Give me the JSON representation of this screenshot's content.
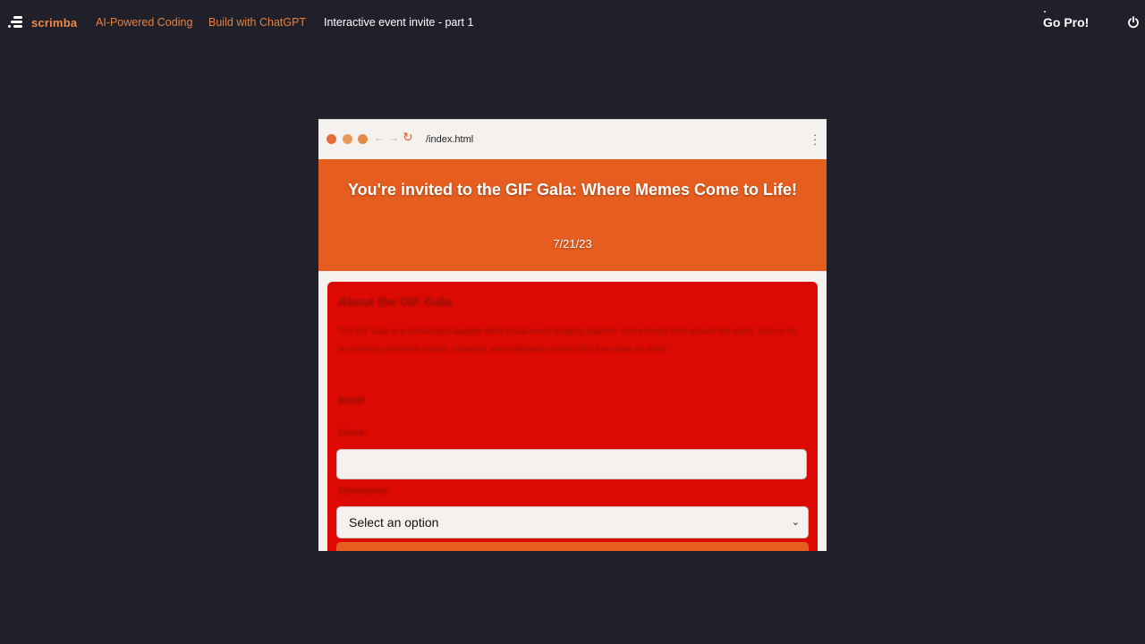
{
  "topbar": {
    "logo_text": "scrimba",
    "breadcrumbs": [
      "AI-Powered Coding",
      "Build with ChatGPT",
      "Interactive event invite - part 1"
    ],
    "go_pro_label": "Go Pro!",
    "power_icon": "power-icon"
  },
  "preview": {
    "url": "/index.html",
    "title": "You're invited to the GIF Gala: Where Memes Come to Life!",
    "date": "7/21/23",
    "card": {
      "heading": "About the GIF Gala",
      "paragraph": "The GIF Gala is a vibrant and laughter-filled virtual event bringing together meme lovers from around the world. Join us for an evening of internet culture, creativity, and celebration of the GIFs that make us smile.",
      "rsvp_heading": "RSVP",
      "name_label": "Name:",
      "attendance_label": "Attendance:",
      "select_value": "Select an option"
    }
  },
  "colors": {
    "background": "#1f2029",
    "accent": "#e55d1f",
    "card": "#dc0a02",
    "crumb": "#e8813f"
  }
}
